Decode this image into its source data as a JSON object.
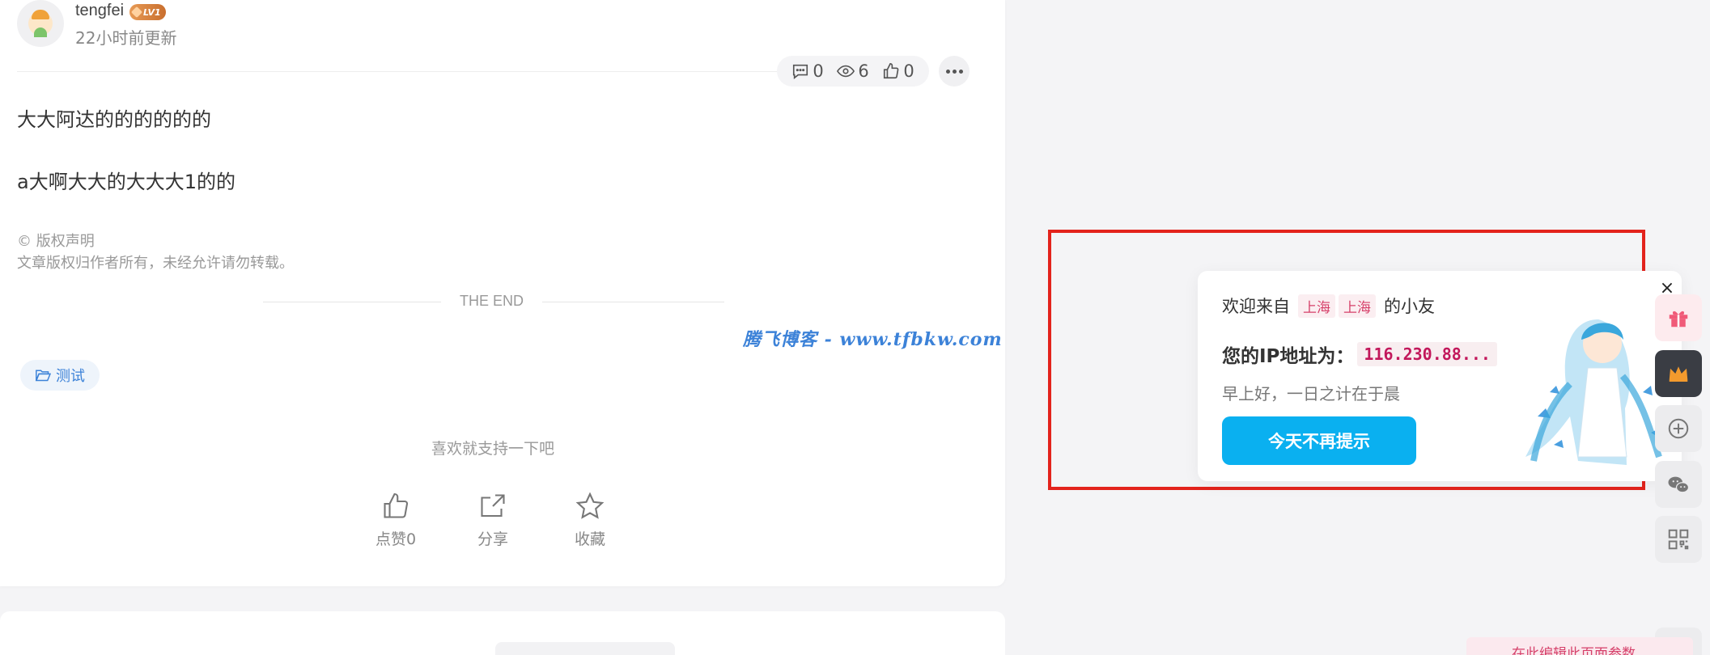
{
  "author": {
    "name": "tengfei",
    "level": "LV1",
    "updated": "22小时前更新"
  },
  "stats": {
    "comments": "0",
    "views": "6",
    "likes": "0"
  },
  "article": {
    "paragraphs": [
      "大大阿达的的的的的的",
      "a大啊大大的大大大1的的"
    ],
    "copyright_title": "© 版权声明",
    "copyright_text": "文章版权归作者所有，未经允许请勿转载。",
    "end_text": "THE END"
  },
  "watermark": "腾飞博客 - www.tfbkw.com",
  "tag": "测试",
  "support": {
    "text": "喜欢就支持一下吧",
    "like_label": "点赞0",
    "share_label": "分享",
    "fav_label": "收藏"
  },
  "popup": {
    "welcome_prefix": "欢迎来自",
    "province": "上海",
    "city": "上海",
    "welcome_suffix": "的小友",
    "ip_label": "您的IP地址为：",
    "ip_value": "116.230.88...",
    "greeting": "早上好，一日之计在于晨",
    "button": "今天不再提示",
    "close": "×"
  },
  "side_buttons": [
    "gift-icon",
    "crown-icon",
    "plus-circle-icon",
    "wechat-icon",
    "qrcode-icon",
    "gear-icon"
  ],
  "edit_hint": "在此编辑此页面参数",
  "colors": {
    "accent": "#0ab0f0",
    "link": "#3c82d8",
    "location": "#d6406a",
    "frame": "#e3231c"
  }
}
